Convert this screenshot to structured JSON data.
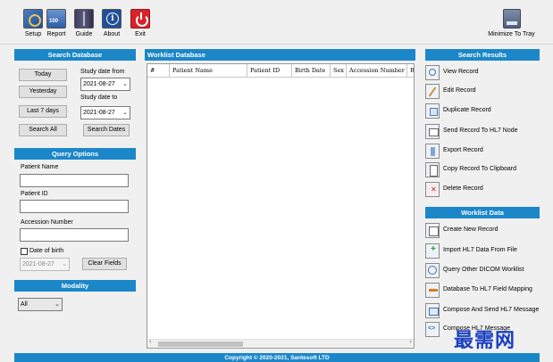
{
  "toolbar": {
    "setup": "Setup",
    "report": "Report",
    "guide": "Guide",
    "about": "About",
    "exit": "Exit",
    "minimize": "Minimize To Tray"
  },
  "search_db": {
    "title": "Search Database",
    "today": "Today",
    "yesterday": "Yesterday",
    "last7": "Last 7 days",
    "search_all": "Search All",
    "date_from_label": "Study date from",
    "date_from": "2021-08-27",
    "date_to_label": "Study date to",
    "date_to": "2021-08-27",
    "search_dates": "Search Dates"
  },
  "query": {
    "title": "Query Options",
    "patient_name_label": "Patient Name",
    "patient_name": "",
    "patient_id_label": "Patient ID",
    "patient_id": "",
    "accession_label": "Accession Number",
    "accession": "",
    "dob_label": "Date of birth",
    "dob": "2021-08-27",
    "clear_fields": "Clear Fields"
  },
  "modality": {
    "title": "Modality",
    "selected": "All"
  },
  "worklist": {
    "title": "Worklist Database",
    "columns": [
      "#",
      "Patient Name",
      "Patient ID",
      "Birth Date",
      "Sex",
      "Accession Number",
      "R"
    ]
  },
  "search_results": {
    "title": "Search Results",
    "items": [
      {
        "label": "View Record"
      },
      {
        "label": "Edit Record"
      },
      {
        "label": "Duplicate Record"
      },
      {
        "label": "Send Record To HL7 Node"
      },
      {
        "label": "Export Record"
      },
      {
        "label": "Copy Record To Clipboard"
      },
      {
        "label": "Delete Record"
      }
    ]
  },
  "worklist_data": {
    "title": "Worklist Data",
    "items": [
      {
        "label": "Create New Record"
      },
      {
        "label": "Import HL7 Data From File"
      },
      {
        "label": "Query Other DICOM Worklist"
      },
      {
        "label": "Database To HL7 Field Mapping"
      },
      {
        "label": "Compose And Send HL7 Message"
      },
      {
        "label": "Compose HL7 Message"
      }
    ]
  },
  "footer": {
    "copyright": "Copyright © 2020-2021, Santesoft LTD"
  },
  "watermark": "最需网",
  "colors": {
    "header_blue": "#1b87c9",
    "exit_red": "#d6232a"
  }
}
